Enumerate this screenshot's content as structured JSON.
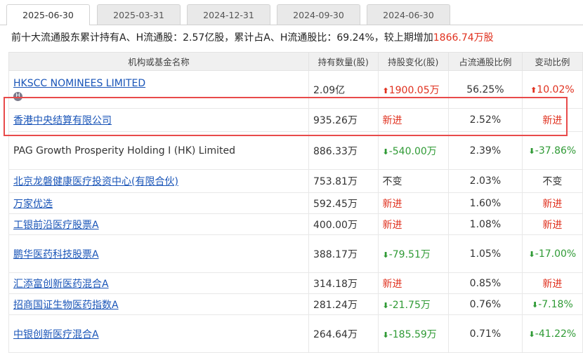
{
  "tabs": [
    "2025-06-30",
    "2025-03-31",
    "2024-12-31",
    "2024-09-30",
    "2024-06-30"
  ],
  "summary": {
    "prefix": "前十大流通股东累计持有A、H流通股：2.57亿股，累计占A、H流通股比：69.24%，较上期增加",
    "increase": "1866.74万股"
  },
  "headers": [
    "机构或基金名称",
    "持有数量(股)",
    "持股变化(股)",
    "占流通股比例",
    "变动比例"
  ],
  "rows": [
    {
      "name": "HKSCC NOMINEES LIMITED",
      "link": true,
      "badge": "H",
      "qty": "2.09亿",
      "chg": "1900.05万",
      "chg_dir": "up",
      "ratio": "56.25%",
      "pct": "10.02%",
      "pct_dir": "up"
    },
    {
      "name": "香港中央结算有限公司",
      "link": true,
      "qty": "935.26万",
      "chg": "新进",
      "chg_dir": "new",
      "ratio": "2.52%",
      "pct": "新进",
      "pct_dir": "new"
    },
    {
      "name": "PAG Growth Prosperity Holding I (HK) Limited",
      "link": false,
      "qty": "886.33万",
      "chg": "-540.00万",
      "chg_dir": "down",
      "ratio": "2.39%",
      "pct": "-37.86%",
      "pct_dir": "down"
    },
    {
      "name": "北京龙磐健康医疗投资中心(有限合伙)",
      "link": true,
      "qty": "753.81万",
      "chg": "不变",
      "chg_dir": "flat",
      "ratio": "2.03%",
      "pct": "不变",
      "pct_dir": "flat"
    },
    {
      "name": "万家优选",
      "link": true,
      "qty": "592.45万",
      "chg": "新进",
      "chg_dir": "new",
      "ratio": "1.60%",
      "pct": "新进",
      "pct_dir": "new"
    },
    {
      "name": "工银前沿医疗股票A",
      "link": true,
      "qty": "400.00万",
      "chg": "新进",
      "chg_dir": "new",
      "ratio": "1.08%",
      "pct": "新进",
      "pct_dir": "new"
    },
    {
      "name": "鹏华医药科技股票A",
      "link": true,
      "qty": "388.17万",
      "chg": "-79.51万",
      "chg_dir": "down",
      "ratio": "1.05%",
      "pct": "-17.00%",
      "pct_dir": "down"
    },
    {
      "name": "汇添富创新医药混合A",
      "link": true,
      "qty": "314.18万",
      "chg": "新进",
      "chg_dir": "new",
      "ratio": "0.85%",
      "pct": "新进",
      "pct_dir": "new"
    },
    {
      "name": "招商国证生物医药指数A",
      "link": true,
      "qty": "281.24万",
      "chg": "-21.75万",
      "chg_dir": "down",
      "ratio": "0.76%",
      "pct": "-7.18%",
      "pct_dir": "down"
    },
    {
      "name": "中银创新医疗混合A",
      "link": true,
      "qty": "264.64万",
      "chg": "-185.59万",
      "chg_dir": "down",
      "ratio": "0.71%",
      "pct": "-41.22%",
      "pct_dir": "down"
    }
  ],
  "colors": {
    "up": "#e0301e",
    "down": "#2f9a35",
    "link": "#1a55b8",
    "highlight": "#e84a4a"
  }
}
